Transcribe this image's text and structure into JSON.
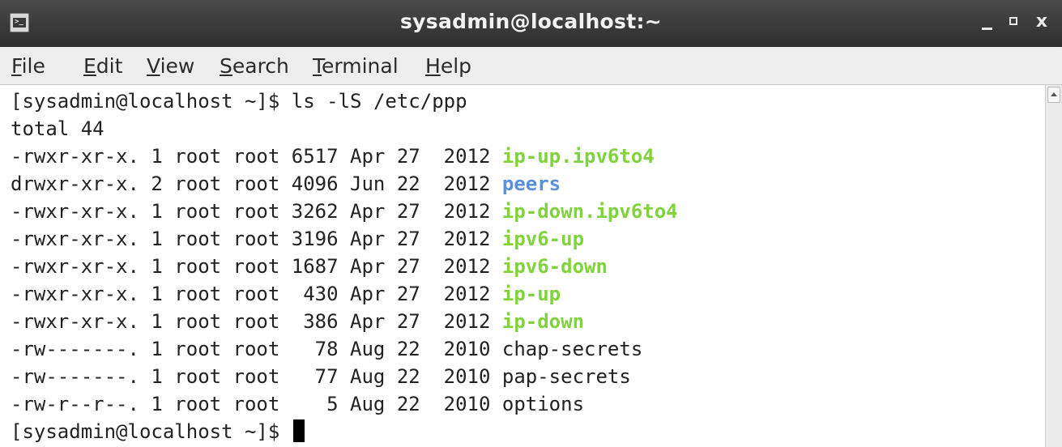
{
  "window": {
    "title": "sysadmin@localhost:~",
    "buttons": {
      "minimize": "_",
      "close": "x"
    }
  },
  "menu": {
    "items": [
      {
        "mnemonic": "F",
        "rest": "ile"
      },
      {
        "mnemonic": "E",
        "rest": "dit"
      },
      {
        "mnemonic": "V",
        "rest": "iew"
      },
      {
        "mnemonic": "S",
        "rest": "earch"
      },
      {
        "mnemonic": "T",
        "rest": "erminal"
      },
      {
        "mnemonic": "H",
        "rest": "elp"
      }
    ]
  },
  "terminal": {
    "prompt": "[sysadmin@localhost ~]$",
    "command": "ls -lS /etc/ppp",
    "total": "total 44",
    "entries": [
      {
        "meta": "-rwxr-xr-x. 1 root root 6517 Apr 27  2012",
        "name": "ip-up.ipv6to4",
        "type": "exec"
      },
      {
        "meta": "drwxr-xr-x. 2 root root 4096 Jun 22  2012",
        "name": "peers",
        "type": "dir"
      },
      {
        "meta": "-rwxr-xr-x. 1 root root 3262 Apr 27  2012",
        "name": "ip-down.ipv6to4",
        "type": "exec"
      },
      {
        "meta": "-rwxr-xr-x. 1 root root 3196 Apr 27  2012",
        "name": "ipv6-up",
        "type": "exec"
      },
      {
        "meta": "-rwxr-xr-x. 1 root root 1687 Apr 27  2012",
        "name": "ipv6-down",
        "type": "exec"
      },
      {
        "meta": "-rwxr-xr-x. 1 root root  430 Apr 27  2012",
        "name": "ip-up",
        "type": "exec"
      },
      {
        "meta": "-rwxr-xr-x. 1 root root  386 Apr 27  2012",
        "name": "ip-down",
        "type": "exec"
      },
      {
        "meta": "-rw-------. 1 root root   78 Aug 22  2010",
        "name": "chap-secrets",
        "type": "file"
      },
      {
        "meta": "-rw-------. 1 root root   77 Aug 22  2010",
        "name": "pap-secrets",
        "type": "file"
      },
      {
        "meta": "-rw-r--r--. 1 root root    5 Aug 22  2010",
        "name": "options",
        "type": "file"
      }
    ],
    "colors": {
      "exec": "#7fd33b",
      "dir": "#5b8fd6",
      "text": "#222222"
    }
  }
}
